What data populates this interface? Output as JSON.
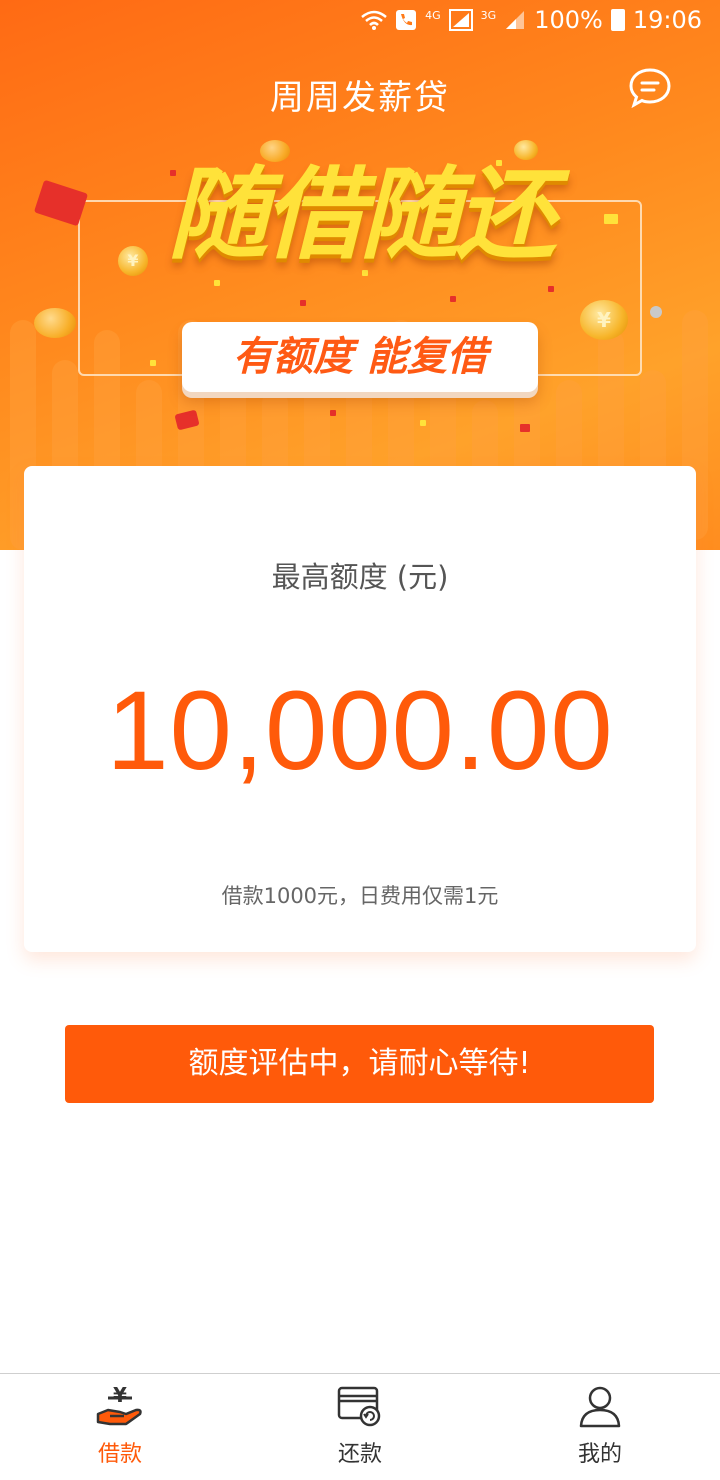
{
  "status_bar": {
    "network_1": "4G",
    "network_2": "3G",
    "battery": "100%",
    "time": "19:06",
    "icons": [
      "wifi-icon",
      "call-icon",
      "signal-icon",
      "signal-icon",
      "battery-icon"
    ]
  },
  "header": {
    "title": "周周发薪贷",
    "chat_icon": "chat-bubble-icon"
  },
  "banner": {
    "headline": "随借随还",
    "subline": "有额度 能复借",
    "coin_symbol": "¥"
  },
  "credit_card": {
    "label": "最高额度 (元)",
    "amount": "10,000.00",
    "note": "借款1000元，日费用仅需1元"
  },
  "action_button": {
    "label": "额度评估中，请耐心等待!"
  },
  "bottom_nav": {
    "items": [
      {
        "label": "借款",
        "icon": "hand-yuan-icon",
        "active": true
      },
      {
        "label": "还款",
        "icon": "card-refund-icon",
        "active": false
      },
      {
        "label": "我的",
        "icon": "user-icon",
        "active": false
      }
    ]
  },
  "colors": {
    "accent": "#ff5a0a",
    "hero_start": "#ff6a14",
    "hero_end": "#ffa22a",
    "nav_active": "#ff5a0a",
    "nav_inactive": "#333333"
  }
}
